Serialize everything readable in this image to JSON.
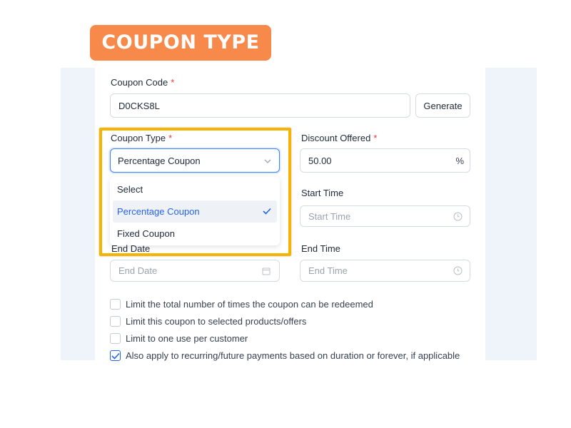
{
  "banner": {
    "title": "COUPON TYPE"
  },
  "form": {
    "coupon_code_label": "Coupon Code",
    "required_mark": "*",
    "coupon_code_value": "D0CKS8L",
    "generate_label": "Generate",
    "coupon_type_label": "Coupon Type",
    "coupon_type_value": "Percentage Coupon",
    "coupon_type_options": [
      "Select",
      "Percentage Coupon",
      "Fixed Coupon"
    ],
    "discount_label": "Discount Offered",
    "discount_value": "50.00",
    "discount_suffix": "%",
    "start_time_label": "Start Time",
    "start_time_placeholder": "Start Time",
    "end_date_label": "End Date",
    "end_date_placeholder": "End Date",
    "end_time_label": "End Time",
    "end_time_placeholder": "End Time"
  },
  "checkboxes": [
    {
      "label": "Limit the total number of times the coupon can be redeemed",
      "checked": false
    },
    {
      "label": "Limit this coupon to selected products/offers",
      "checked": false
    },
    {
      "label": "Limit to one use per customer",
      "checked": false
    },
    {
      "label": "Also apply to recurring/future payments based on duration or forever, if applicable",
      "checked": true
    }
  ],
  "colors": {
    "accent": "#2563eb",
    "banner": "#f7894a",
    "highlight": "#f4b400",
    "required": "#e53935"
  }
}
